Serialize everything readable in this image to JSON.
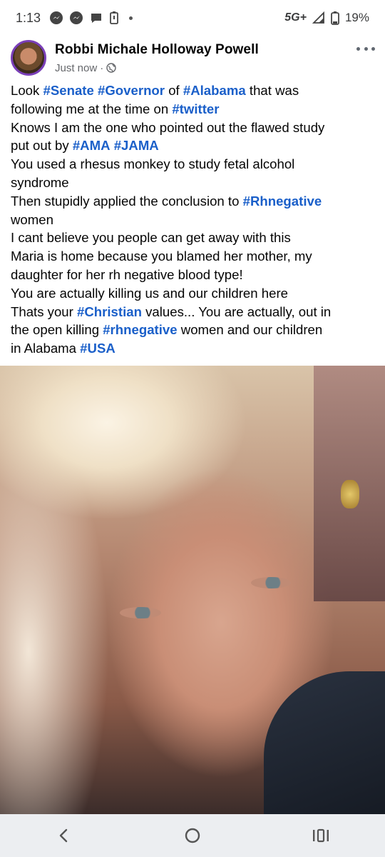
{
  "status_bar": {
    "time": "1:13",
    "network": "5G+",
    "battery_percent": "19%",
    "icons": [
      "messenger-icon",
      "messenger-icon",
      "chat-bubble-icon",
      "battery-saver-icon",
      "dot-icon",
      "signal-icon",
      "battery-icon"
    ]
  },
  "post": {
    "author_name": "Robbi Michale Holloway Powell",
    "timestamp": "Just now",
    "separator": "·",
    "audience_icon": "globe-icon",
    "lines": [
      [
        {
          "t": "Look "
        },
        {
          "t": "#Senate",
          "h": true
        },
        {
          "t": " "
        },
        {
          "t": "#Governor",
          "h": true
        },
        {
          "t": " of "
        },
        {
          "t": "#Alabama",
          "h": true
        },
        {
          "t": " that was"
        }
      ],
      [
        {
          "t": "following me at the time on "
        },
        {
          "t": "#twitter",
          "h": true
        }
      ],
      [
        {
          "t": "Knows I am the one who pointed out the flawed study"
        }
      ],
      [
        {
          "t": "put out by "
        },
        {
          "t": "#AMA",
          "h": true
        },
        {
          "t": " "
        },
        {
          "t": "#JAMA",
          "h": true
        }
      ],
      [
        {
          "t": "You used a rhesus monkey to study fetal alcohol"
        }
      ],
      [
        {
          "t": "syndrome"
        }
      ],
      [
        {
          "t": "Then stupidly applied the conclusion to "
        },
        {
          "t": "#Rhnegative",
          "h": true
        }
      ],
      [
        {
          "t": "women"
        }
      ],
      [
        {
          "t": "I cant believe you people can get away with this"
        }
      ],
      [
        {
          "t": "Maria is home because you blamed her mother, my"
        }
      ],
      [
        {
          "t": "daughter for her rh negative blood type!"
        }
      ],
      [
        {
          "t": "You are actually killing us and our children here"
        }
      ],
      [
        {
          "t": "Thats your "
        },
        {
          "t": "#Christian",
          "h": true
        },
        {
          "t": " values... You are actually, out in"
        }
      ],
      [
        {
          "t": "the open  killing "
        },
        {
          "t": "#rhnegative",
          "h": true
        },
        {
          "t": " women and our children"
        }
      ],
      [
        {
          "t": "in Alabama "
        },
        {
          "t": "#USA",
          "h": true
        }
      ]
    ]
  },
  "colors": {
    "hashtag": "#1a5fc9",
    "avatar_ring": "#7a3fb8",
    "nav_background": "#eceef1"
  },
  "nav_bar": {
    "buttons": [
      "back-icon",
      "home-icon",
      "recents-icon"
    ]
  }
}
